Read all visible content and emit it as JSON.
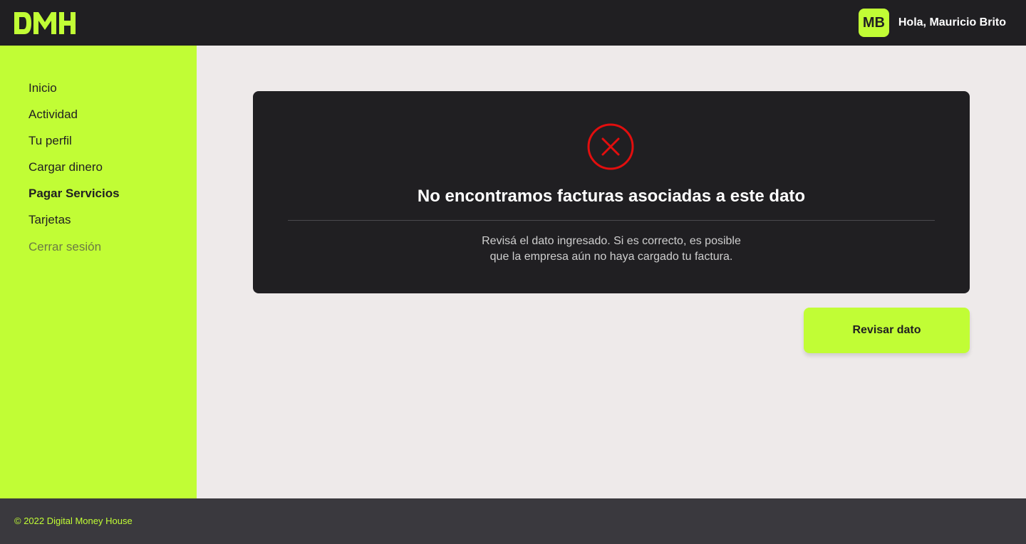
{
  "colors": {
    "accent": "#C1FD35",
    "dark": "#201F22",
    "background": "#EEEAEA",
    "footer": "#3A393E",
    "error": "#E20E0E"
  },
  "header": {
    "logo_text": "DMH",
    "avatar_initials": "MB",
    "greeting": "Hola, Mauricio Brito"
  },
  "sidebar": {
    "items": [
      {
        "label": "Inicio"
      },
      {
        "label": "Actividad"
      },
      {
        "label": "Tu perfil"
      },
      {
        "label": "Cargar dinero"
      },
      {
        "label": "Pagar Servicios",
        "active": true
      },
      {
        "label": "Tarjetas"
      },
      {
        "label": "Cerrar sesión"
      }
    ]
  },
  "error_card": {
    "icon": "error-x-circle-icon",
    "title": "No encontramos facturas asociadas a este dato",
    "message_line1": "Revisá el dato ingresado. Si es correcto, es posible",
    "message_line2": "que la empresa aún no haya cargado tu factura."
  },
  "actions": {
    "review_button": "Revisar dato"
  },
  "footer": {
    "copyright": "© 2022 Digital Money House"
  }
}
